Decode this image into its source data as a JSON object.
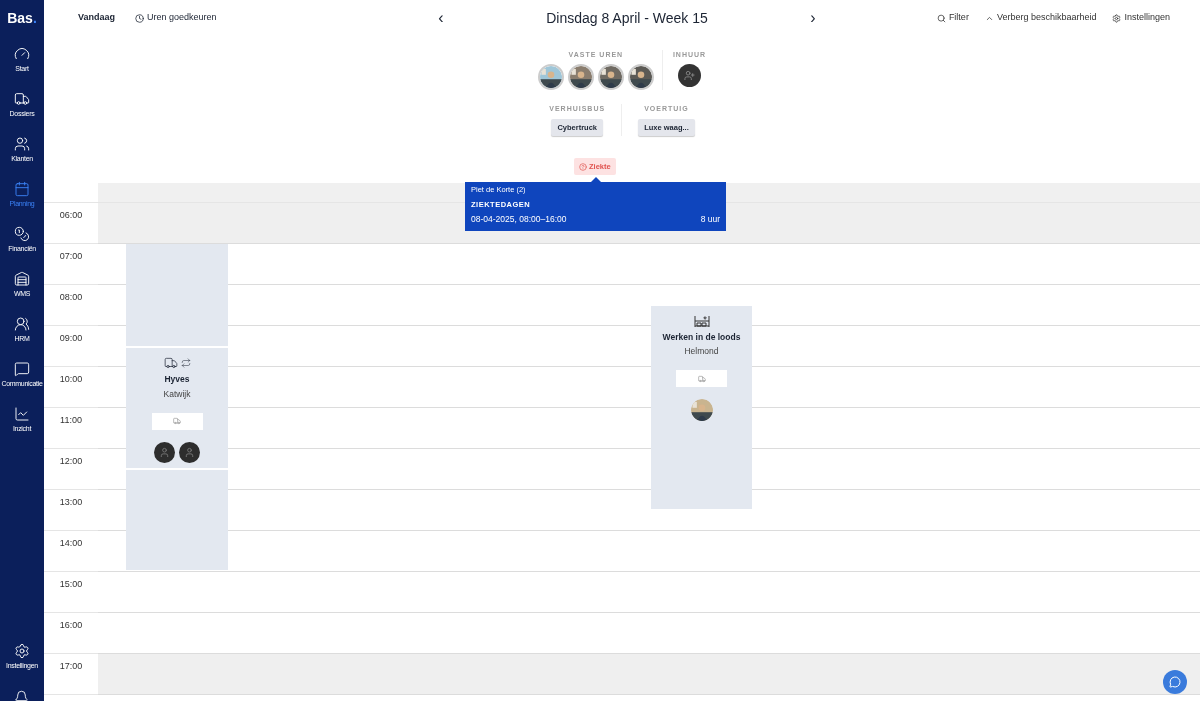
{
  "sidebar": {
    "logo": "Bas",
    "logo_dot": ".",
    "items": [
      {
        "label": "Start",
        "selected": false
      },
      {
        "label": "Dossiers",
        "selected": false
      },
      {
        "label": "Klanten",
        "selected": false
      },
      {
        "label": "Planning",
        "selected": true
      },
      {
        "label": "Financiën",
        "selected": false
      },
      {
        "label": "WMS",
        "selected": false
      },
      {
        "label": "HRM",
        "selected": false
      },
      {
        "label": "Communicatie",
        "selected": false
      },
      {
        "label": "Inzicht",
        "selected": false
      }
    ],
    "bottom_items": [
      {
        "label": "Instellingen",
        "selected": false
      },
      {
        "kind": "bell"
      }
    ]
  },
  "toolbar": {
    "today": "Vandaag",
    "approve_hours": "Uren goedkeuren",
    "prev": "‹",
    "title": "Dinsdag 8 April - Week 15",
    "next": "›",
    "actions": [
      "Filter",
      "Verberg beschikbaarheid",
      "Instellingen"
    ]
  },
  "resources": {
    "fixed_hours": {
      "label": "VASTE UREN"
    },
    "hire": {
      "label": "INHUUR"
    },
    "vans": {
      "label": "VERHUISBUS",
      "items": [
        "Cybertruck"
      ]
    },
    "vehicles": {
      "label": "VOERTUIG",
      "items": [
        "Luxe waag..."
      ]
    }
  },
  "absence": {
    "badge": "Ziekte",
    "tooltip": {
      "name": "Piet de Korte (2)",
      "type": "ZIEKTEDAGEN",
      "period": "08-04-2025, 08:00–16:00",
      "hours": "8 uur"
    }
  },
  "hours": [
    {
      "time": "06:00",
      "shaded": true
    },
    {
      "time": "07:00",
      "shaded": false
    },
    {
      "time": "08:00",
      "shaded": false
    },
    {
      "time": "09:00",
      "shaded": false
    },
    {
      "time": "10:00",
      "shaded": false
    },
    {
      "time": "11:00",
      "shaded": false
    },
    {
      "time": "12:00",
      "shaded": false
    },
    {
      "time": "13:00",
      "shaded": false
    },
    {
      "time": "14:00",
      "shaded": false
    },
    {
      "time": "15:00",
      "shaded": false
    },
    {
      "time": "16:00",
      "shaded": false
    },
    {
      "time": "17:00",
      "shaded": true
    }
  ],
  "events": [
    {
      "kind": "move",
      "title": "Hyves",
      "location": "Katwijk",
      "staff": [
        {
          "kind": "unknown"
        },
        {
          "kind": "unknown"
        }
      ]
    },
    {
      "kind": "warehouse",
      "title": "Werken in de loods",
      "location": "Helmond"
    }
  ]
}
